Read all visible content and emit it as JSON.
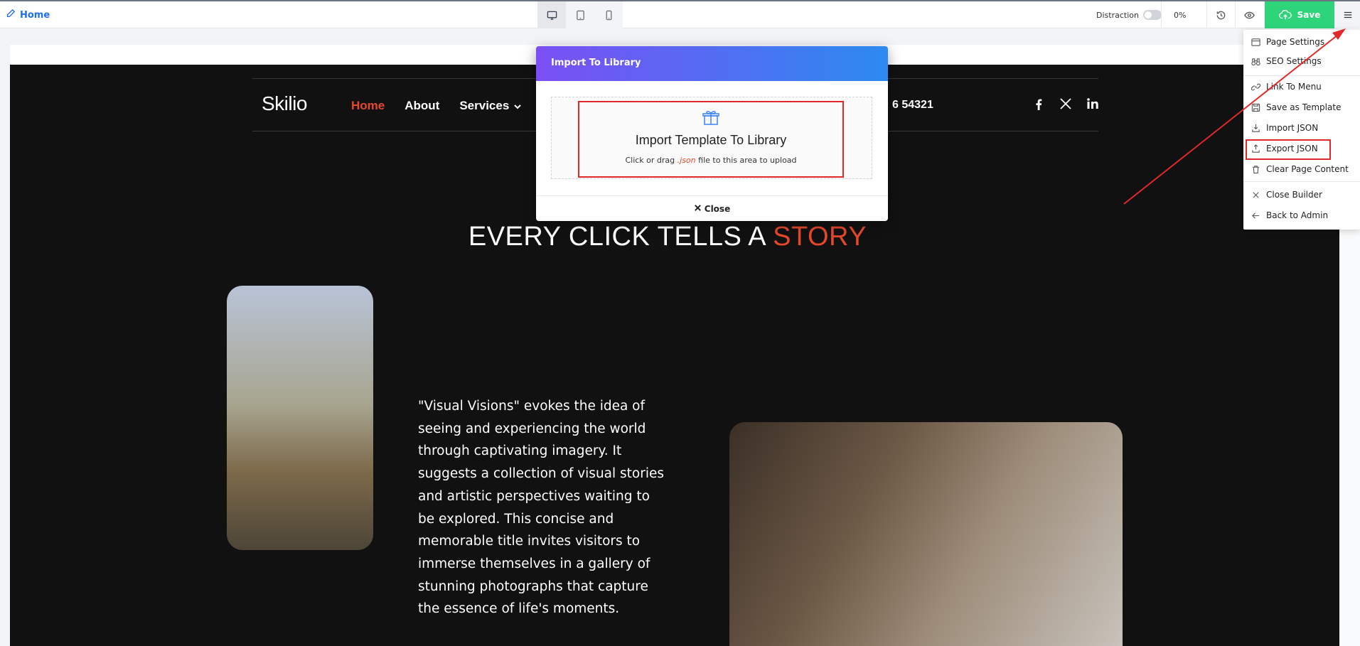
{
  "toolbar": {
    "home_label": "Home",
    "distraction_label": "Distraction",
    "zoom": "0%",
    "save_label": "Save"
  },
  "site": {
    "logo": "Skilio",
    "nav": [
      {
        "label": "Home"
      },
      {
        "label": "About"
      },
      {
        "label": "Services"
      }
    ],
    "phone_partial": "6 54321",
    "hero_prefix": "EVERY CLICK TELLS A ",
    "hero_accent": "STORY",
    "paragraph": "\"Visual Visions\" evokes the idea of seeing and experiencing the world through captivating imagery. It suggests a collection of visual stories and artistic perspectives waiting to be explored. This concise and memorable title invites visitors to immerse themselves in a gallery of stunning photographs that capture the essence of life's moments."
  },
  "modal": {
    "title": "Import To Library",
    "drop_title": "Import Template To Library",
    "drop_sub_prefix": "Click or drag ",
    "drop_sub_ext": ".json",
    "drop_sub_suffix": " file to this area to upload",
    "close_label": "Close"
  },
  "menu": {
    "items": [
      {
        "label": "Page Settings",
        "icon": "layout-icon"
      },
      {
        "label": "SEO Settings",
        "icon": "binoculars-icon"
      },
      {
        "label": "Link To Menu",
        "icon": "link-icon"
      },
      {
        "label": "Save as Template",
        "icon": "save-icon"
      },
      {
        "label": "Import JSON",
        "icon": "import-icon"
      },
      {
        "label": "Export JSON",
        "icon": "export-icon"
      },
      {
        "label": "Clear Page Content",
        "icon": "trash-icon"
      },
      {
        "label": "Close Builder",
        "icon": "close-icon"
      },
      {
        "label": "Back to Admin",
        "icon": "arrow-left-icon"
      }
    ]
  },
  "colors": {
    "accent": "#e5482b",
    "save_green": "#2ed47a",
    "annotation_red": "#e12929"
  }
}
